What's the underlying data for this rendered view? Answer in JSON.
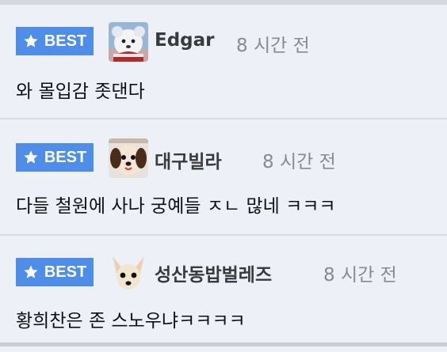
{
  "badge_label": "BEST",
  "colors": {
    "badge": "#4e8de8",
    "background": "#eef0f7",
    "username": "#3a3a3a",
    "time": "#8a8a8a"
  },
  "comments": [
    {
      "username": "Edgar",
      "time": "8 시간 전",
      "text": "와 몰입감 좃댄다",
      "avatar": "white-plush-avatar",
      "badge_icon": "star-icon"
    },
    {
      "username": "대구빌라",
      "time": "8 시간 전",
      "text": "다들 철원에 사나 궁예들 ㅈㄴ 많네 ㅋㅋㅋ",
      "avatar": "dog-avatar",
      "badge_icon": "star-icon"
    },
    {
      "username": "성산동밥벌레즈",
      "time": "8 시간 전",
      "text": "황희찬은 존 스노우냐ㅋㅋㅋㅋ",
      "avatar": "chihuahua-avatar",
      "badge_icon": "star-icon"
    }
  ]
}
